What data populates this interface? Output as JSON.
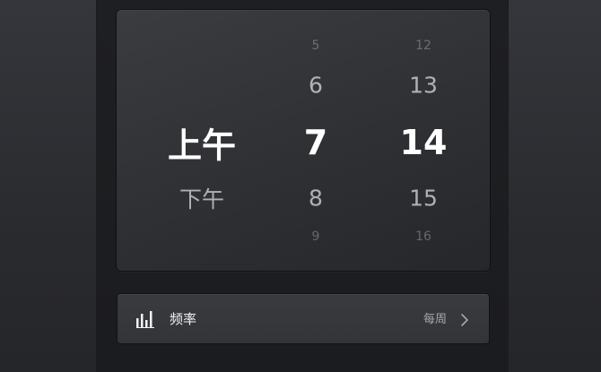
{
  "picker": {
    "ampm": {
      "m1": "",
      "m2": "",
      "selected": "上午",
      "p1": "下午",
      "p2": ""
    },
    "hour": {
      "m2": "5",
      "m1": "6",
      "selected": "7",
      "p1": "8",
      "p2": "9"
    },
    "minute": {
      "m2": "12",
      "m1": "13",
      "selected": "14",
      "p1": "15",
      "p2": "16"
    }
  },
  "frequency": {
    "icon": "bar-chart-icon",
    "label": "频率",
    "value": "每周",
    "chevron_icon": "chevron-right-icon"
  }
}
